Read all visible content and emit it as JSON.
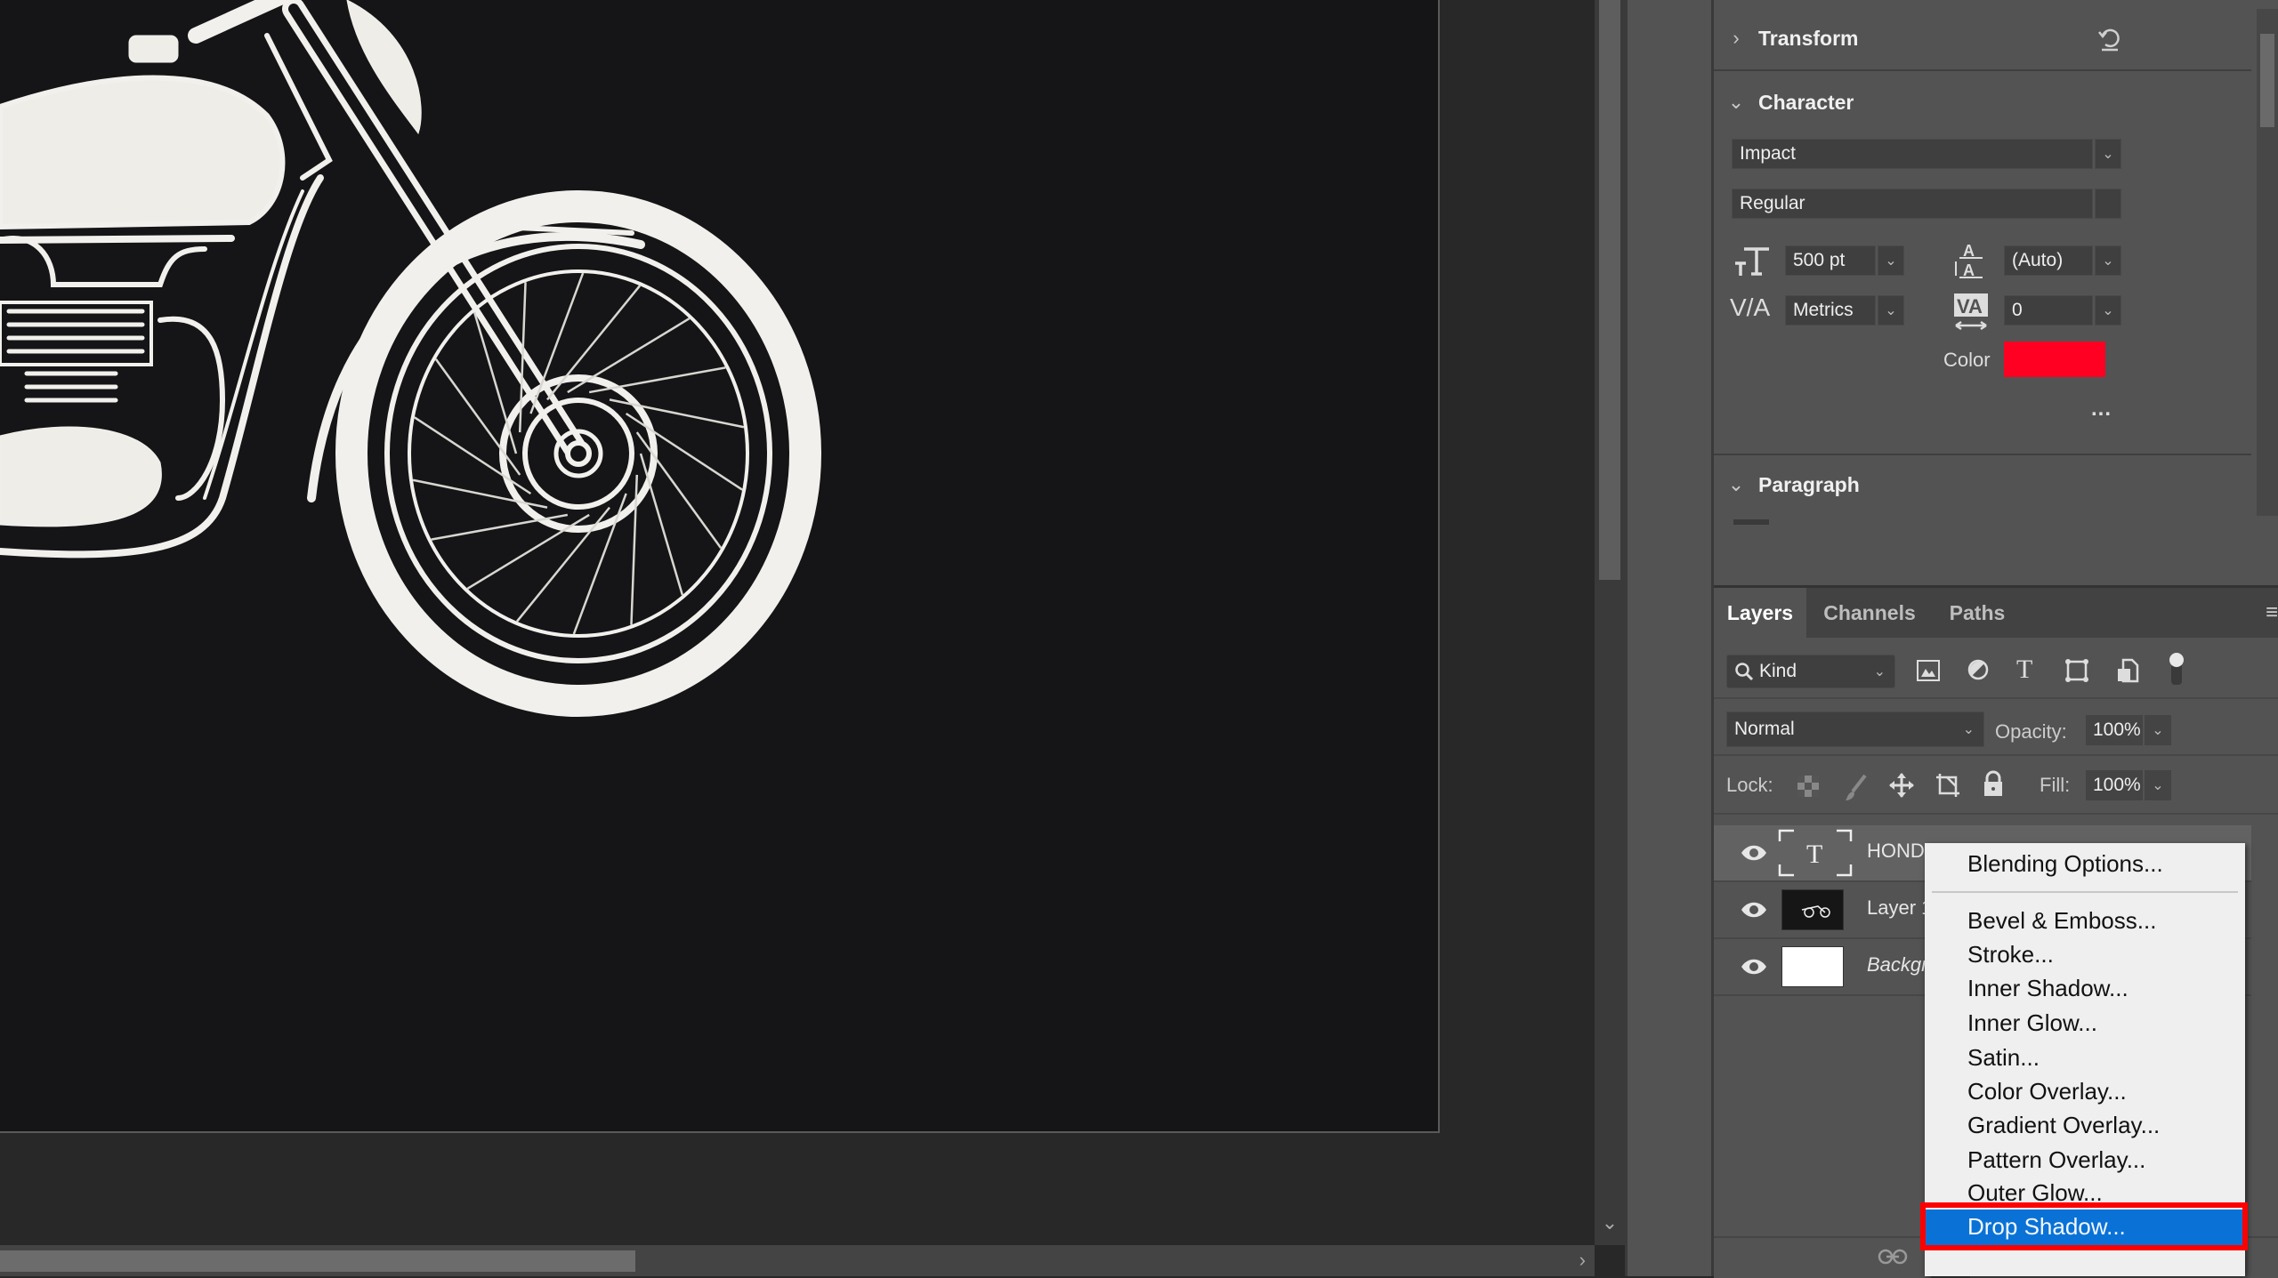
{
  "document": {
    "canvas_artwork": "motorcycle-illustration"
  },
  "properties": {
    "transform": {
      "title": "Transform",
      "expanded": false
    },
    "character": {
      "title": "Character",
      "expanded": true,
      "font_family": "Impact",
      "font_style": "Regular",
      "font_size": "500 pt",
      "leading": "(Auto)",
      "kerning": "Metrics",
      "tracking": "0",
      "color_label": "Color",
      "color_value": "#ff0022",
      "more_label": "..."
    },
    "paragraph": {
      "title": "Paragraph",
      "expanded": true
    }
  },
  "layers_panel": {
    "tabs": [
      {
        "label": "Layers",
        "active": true
      },
      {
        "label": "Channels",
        "active": false
      },
      {
        "label": "Paths",
        "active": false
      }
    ],
    "filter_label": "Kind",
    "blend_mode": "Normal",
    "opacity_label": "Opacity:",
    "opacity_value": "100%",
    "lock_label": "Lock:",
    "fill_label": "Fill:",
    "fill_value": "100%",
    "layers": [
      {
        "name": "HONDA",
        "type": "text",
        "visible": true,
        "selected": true
      },
      {
        "name": "Layer 1",
        "type": "image",
        "visible": true,
        "selected": false
      },
      {
        "name": "Background",
        "type": "background",
        "visible": true,
        "selected": false
      }
    ]
  },
  "context_menu": {
    "items": [
      "Blending Options...",
      "Bevel & Emboss...",
      "Stroke...",
      "Inner Shadow...",
      "Inner Glow...",
      "Satin...",
      "Color Overlay...",
      "Gradient Overlay...",
      "Pattern Overlay...",
      "Outer Glow...",
      "Drop Shadow..."
    ],
    "highlighted_item": "Drop Shadow...",
    "highlight_color": "#0a72d6",
    "annotation_box_color": "#ff0000"
  }
}
